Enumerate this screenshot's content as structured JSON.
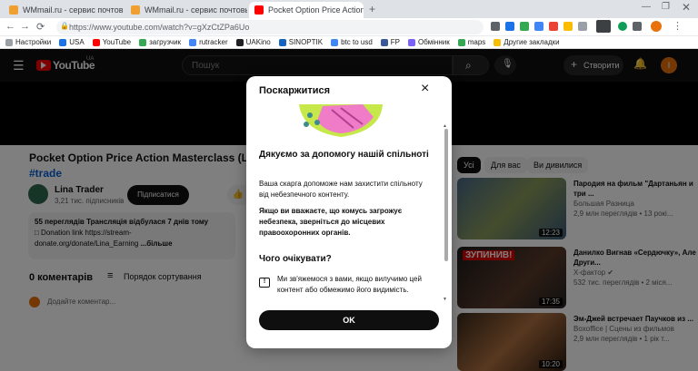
{
  "browser": {
    "tabs": [
      {
        "title": "WMmail.ru - сервис почтовых рас",
        "close": "×"
      },
      {
        "title": "WMmail.ru - сервис почтовых рас",
        "close": "×"
      },
      {
        "title": "Pocket Option Price Action M",
        "close": "×"
      }
    ],
    "new_tab": "+",
    "url": "https://www.youtube.com/watch?v=gXzCtZPa6Uo",
    "bookmarks": [
      "Настройки",
      "USA",
      "YouTube",
      "загрузчик",
      "rutracker",
      "UAKino",
      "SINOPTIK",
      "btc to usd",
      "FP",
      "Обмінник",
      "maps",
      "Другие закладки"
    ]
  },
  "youtube": {
    "logo": "YouTube",
    "country": "UA",
    "search_placeholder": "Пошук",
    "create_label": "Створити",
    "avatar_letter": "I"
  },
  "video": {
    "title": "Pocket Option Price Action Masterclass (Live Se",
    "hashtag": "#trade",
    "channel": "Lina Trader",
    "subscribers": "3,21 тис. підписників",
    "subscribe_label": "Підписатися",
    "desc_line1": "55 переглядів  Трансляція відбулася 7 днів тому",
    "desc_line2": "□ Donation link https://stream-",
    "desc_line3": "donate.org/donate/Lina_Earning",
    "more": "...більше",
    "comments_count": "0 коментарів",
    "sort_label": "Порядок сортування",
    "comment_placeholder": "Додайте коментар..."
  },
  "chips": [
    "Усі",
    "Для вас",
    "Ви дивилися"
  ],
  "recommendations": [
    {
      "title": "Пародия на фильм \"Дартаньян и три ...",
      "channel": "Большая Разница",
      "meta": "2,9 млн переглядів • 13 рокі...",
      "duration": "12:23",
      "thumb_text": ""
    },
    {
      "title": "Данилко Вигнав «Сердючку», Але Други...",
      "channel": "Х-фактор",
      "meta": "532 тис. переглядів • 2 міся...",
      "duration": "17:35",
      "thumb_text": "ЗУПИНИВ!"
    },
    {
      "title": "Эм-Джей встречает Паучков из ...",
      "channel": "Boxoffice | Сцены из фильмов",
      "meta": "2,9 млн переглядів • 1 рік т...",
      "duration": "10:20",
      "thumb_text": ""
    }
  ],
  "modal": {
    "title": "Поскаржитися",
    "close": "×",
    "heading": "Дякуємо за допомогу нашій спільноті",
    "para1": "Ваша скарга допоможе нам захистити спільноту від небезпечного контенту.",
    "para2": "Якщо ви вважаєте, що комусь загрожує небезпека, зверніться до місцевих правоохоронних органів.",
    "subheading": "Чого очікувати?",
    "para3": "Ми зв'яжемося з вами, якщо вилучимо цей контент або обмежимо його видимість.",
    "ok_label": "OK"
  }
}
